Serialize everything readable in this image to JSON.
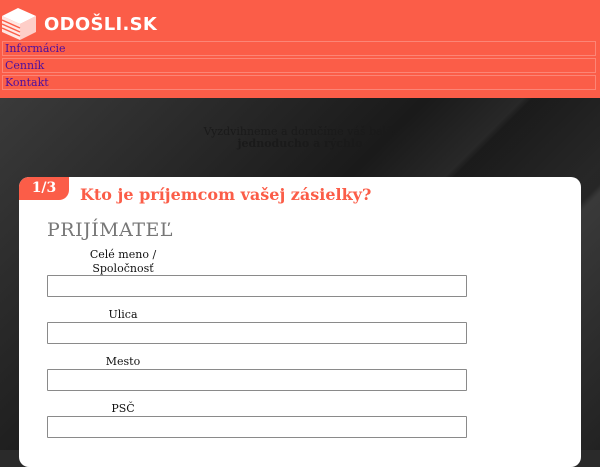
{
  "brand": {
    "name": "ODOŠLI.SK",
    "accent": "#fb5d48"
  },
  "nav": [
    {
      "label": "Informácie"
    },
    {
      "label": "Cenník"
    },
    {
      "label": "Kontakt"
    }
  ],
  "tagline": {
    "line1": "Vyzdvihneme a doručíme váš balík",
    "line2": "jednoducho a rýchlo"
  },
  "form": {
    "step": "1/3",
    "question": "Kto je príjemcom vašej zásielky?",
    "section_title": "PRIJÍMATEĽ",
    "fields": [
      {
        "label": "Celé meno / Spoločnosť",
        "value": ""
      },
      {
        "label": "Ulica",
        "value": ""
      },
      {
        "label": "Mesto",
        "value": ""
      },
      {
        "label": "PSČ",
        "value": ""
      }
    ]
  }
}
